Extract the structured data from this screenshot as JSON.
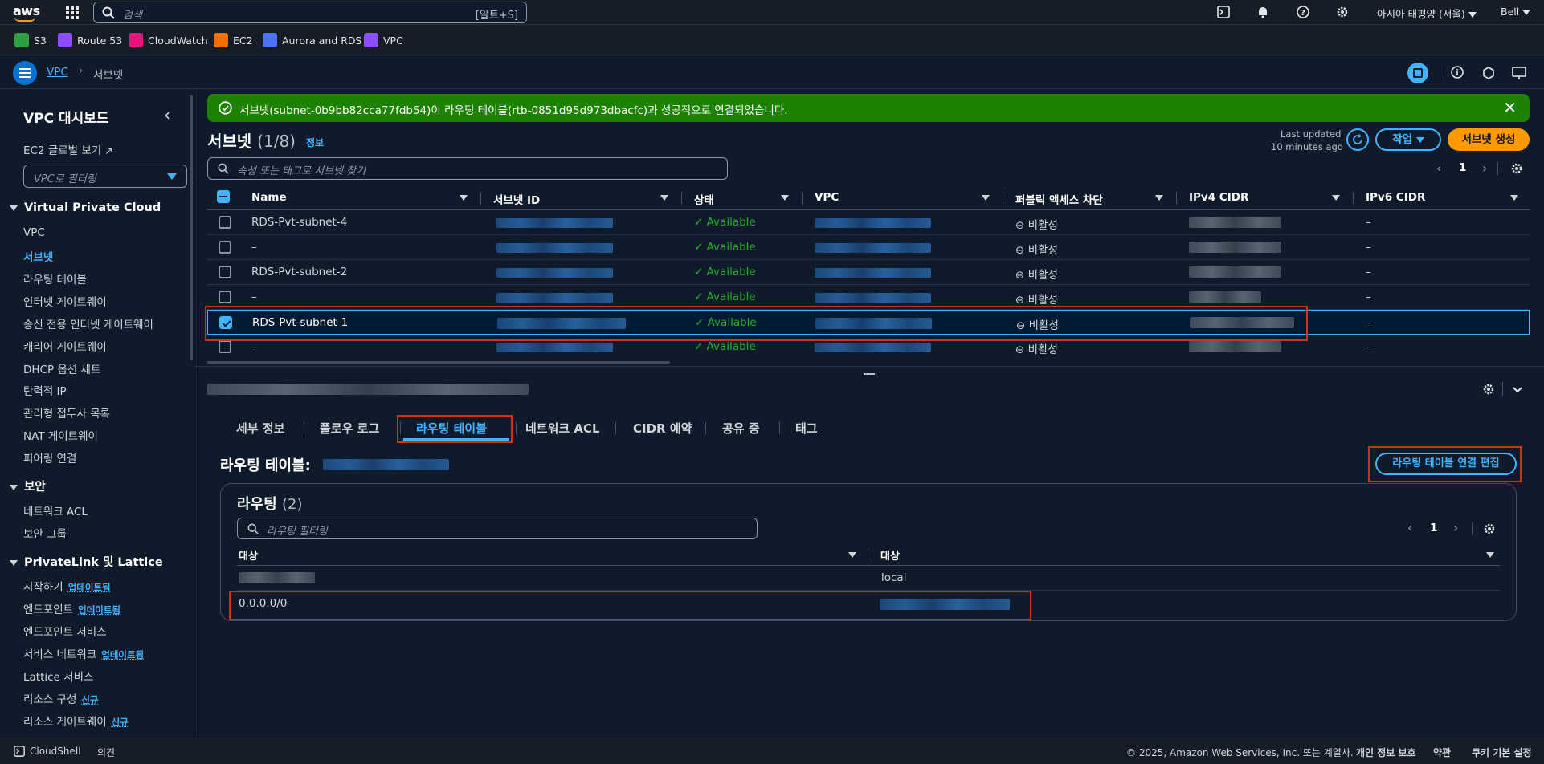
{
  "topbar": {
    "logo": "aws",
    "search_placeholder": "검색",
    "search_shortcut": "[알트+S]",
    "region": "아시아 태평양 (서울)",
    "user": "Bell",
    "icons": [
      "cloudshell-icon",
      "bell-icon",
      "help-icon",
      "gear-icon"
    ]
  },
  "favorites": [
    {
      "label": "S3",
      "color": "#2ea043"
    },
    {
      "label": "Route 53",
      "color": "#8c4fff"
    },
    {
      "label": "CloudWatch",
      "color": "#e7157b"
    },
    {
      "label": "EC2",
      "color": "#ed7100"
    },
    {
      "label": "Aurora and RDS",
      "color": "#4d72f3"
    },
    {
      "label": "VPC",
      "color": "#8c4fff"
    }
  ],
  "breadcrumb": {
    "root": "VPC",
    "current": "서브넷"
  },
  "sidebar": {
    "title": "VPC 대시보드",
    "ec2_global": "EC2 글로벌 보기",
    "filter_placeholder": "VPC로 필터링",
    "sections": [
      {
        "title": "Virtual Private Cloud",
        "items": [
          "VPC",
          "서브넷",
          "라우팅 테이블",
          "인터넷 게이트웨이",
          "송신 전용 인터넷 게이트웨이",
          "캐리어 게이트웨이",
          "DHCP 옵션 세트",
          "탄력적 IP",
          "관리형 접두사 목록",
          "NAT 게이트웨이",
          "피어링 연결"
        ]
      },
      {
        "title": "보안",
        "items": [
          "네트워크 ACL",
          "보안 그룹"
        ]
      },
      {
        "title": "PrivateLink 및 Lattice",
        "items": [
          "시작하기",
          "엔드포인트",
          "엔드포인트 서비스",
          "서비스 네트워크",
          "Lattice 서비스",
          "리소스 구성",
          "리소스 게이트웨이"
        ]
      }
    ],
    "badges": {
      "updated": "업데이트됨",
      "new": "신규"
    }
  },
  "flash": {
    "message": "서브넷(subnet-0b9bb82cca77fdb54)이 라우팅 테이블(rtb-0851d95d973dbacfc)과 성공적으로 연결되었습니다."
  },
  "subnets": {
    "title": "서브넷",
    "count": "(1/8)",
    "info": "정보",
    "last_updated_label": "Last updated",
    "last_updated_value": "10 minutes ago",
    "actions_button": "작업",
    "create_button": "서브넷 생성",
    "filter_placeholder": "속성 또는 태그로 서브넷 찾기",
    "page": "1",
    "columns": [
      "Name",
      "서브넷 ID",
      "상태",
      "VPC",
      "퍼블릭 액세스 차단",
      "IPv4 CIDR",
      "IPv6 CIDR"
    ],
    "rows": [
      {
        "name": "RDS-Pvt-subnet-4",
        "state": "Available",
        "block": "비활성",
        "ipv6": "–",
        "selected": false
      },
      {
        "name": "–",
        "state": "Available",
        "block": "비활성",
        "ipv6": "–",
        "selected": false
      },
      {
        "name": "RDS-Pvt-subnet-2",
        "state": "Available",
        "block": "비활성",
        "ipv6": "–",
        "selected": false
      },
      {
        "name": "–",
        "state": "Available",
        "block": "비활성",
        "ipv6": "–",
        "selected": false
      },
      {
        "name": "RDS-Pvt-subnet-1",
        "state": "Available",
        "block": "비활성",
        "ipv6": "–",
        "selected": true
      },
      {
        "name": "–",
        "state": "Available",
        "block": "비활성",
        "ipv6": "–",
        "selected": false
      }
    ]
  },
  "details": {
    "tabs": [
      "세부 정보",
      "플로우 로그",
      "라우팅 테이블",
      "네트워크 ACL",
      "CIDR 예약",
      "공유 중",
      "태그"
    ],
    "active_tab": "라우팅 테이블",
    "route_table_label": "라우팅 테이블:",
    "edit_button": "라우팅 테이블 연결 편집",
    "routes_title": "라우팅",
    "routes_count": "(2)",
    "routes_filter_placeholder": "라우팅 필터링",
    "routes_page": "1",
    "route_columns": [
      "대상",
      "대상"
    ],
    "routes": [
      {
        "destination": "",
        "target": "local"
      },
      {
        "destination": "0.0.0.0/0",
        "target": ""
      }
    ]
  },
  "footer": {
    "cloudshell": "CloudShell",
    "feedback": "의견",
    "copyright": "© 2025, Amazon Web Services, Inc. 또는 계열사.",
    "privacy": "개인 정보 보호",
    "terms": "약관",
    "cookies": "쿠키 기본 설정"
  }
}
